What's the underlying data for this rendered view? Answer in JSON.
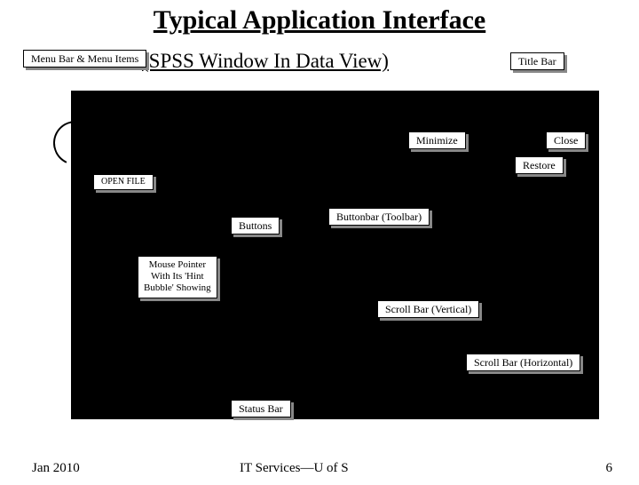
{
  "title": "Typical Application Interface",
  "subtitle": "(SPSS Window In Data View)",
  "labels": {
    "menu_bar": "Menu Bar & Menu Items",
    "title_bar": "Title Bar",
    "minimize": "Minimize",
    "close": "Close",
    "restore": "Restore",
    "open_file": "OPEN FILE",
    "buttons": "Buttons",
    "buttonbar": "Buttonbar (Toolbar)",
    "mouse_pointer": "Mouse Pointer\nWith Its 'Hint\nBubble' Showing",
    "scroll_v": "Scroll Bar (Vertical)",
    "scroll_h": "Scroll Bar (Horizontal)",
    "status_bar": "Status Bar"
  },
  "footer": {
    "left": "Jan 2010",
    "center": "IT Services—U of  S",
    "right": "6"
  }
}
